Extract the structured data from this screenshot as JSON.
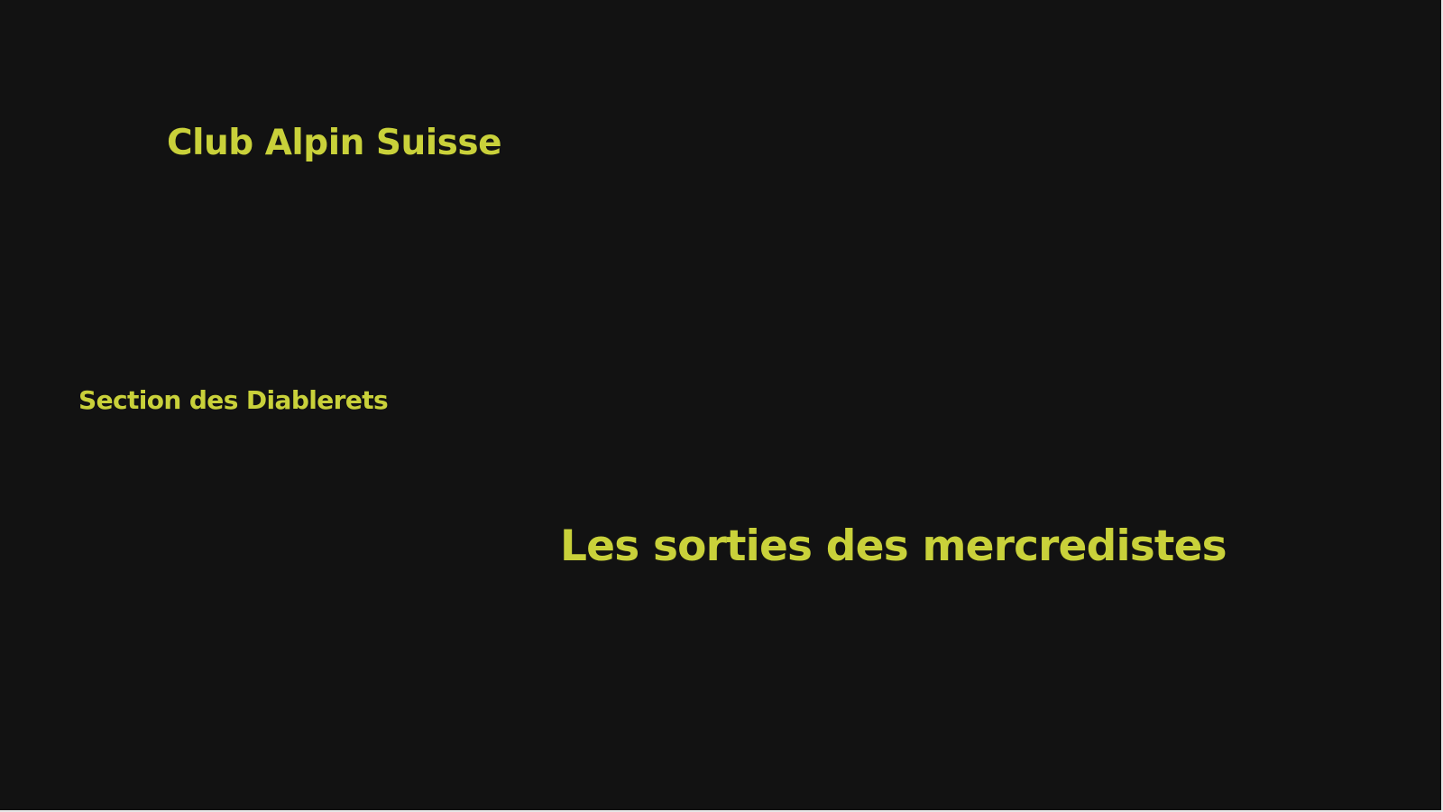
{
  "slide": {
    "organization": "Club Alpin Suisse",
    "section": "Section des Diablerets",
    "title": "Les sorties des mercredistes"
  },
  "colors": {
    "background": "#121212",
    "text_accent": "#c9d13a"
  }
}
